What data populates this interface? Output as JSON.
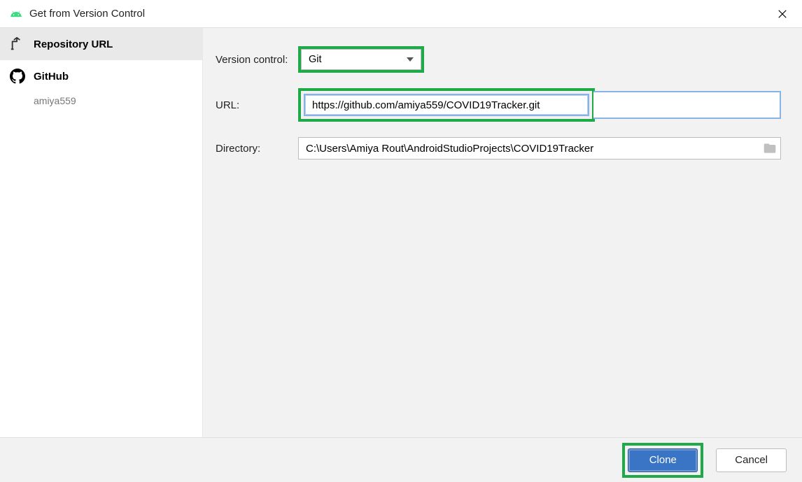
{
  "title": "Get from Version Control",
  "sidebar": {
    "items": [
      {
        "label": "Repository URL",
        "selected": true
      },
      {
        "label": "GitHub",
        "sub": "amiya559"
      }
    ]
  },
  "form": {
    "vc_label": "Version control:",
    "vc_value": "Git",
    "url_label": "URL:",
    "url_value": "https://github.com/amiya559/COVID19Tracker.git",
    "dir_label": "Directory:",
    "dir_value": "C:\\Users\\Amiya Rout\\AndroidStudioProjects\\COVID19Tracker"
  },
  "footer": {
    "clone_label": "Clone",
    "cancel_label": "Cancel"
  },
  "colors": {
    "highlight": "#1fa948",
    "primary": "#3a74c4"
  }
}
